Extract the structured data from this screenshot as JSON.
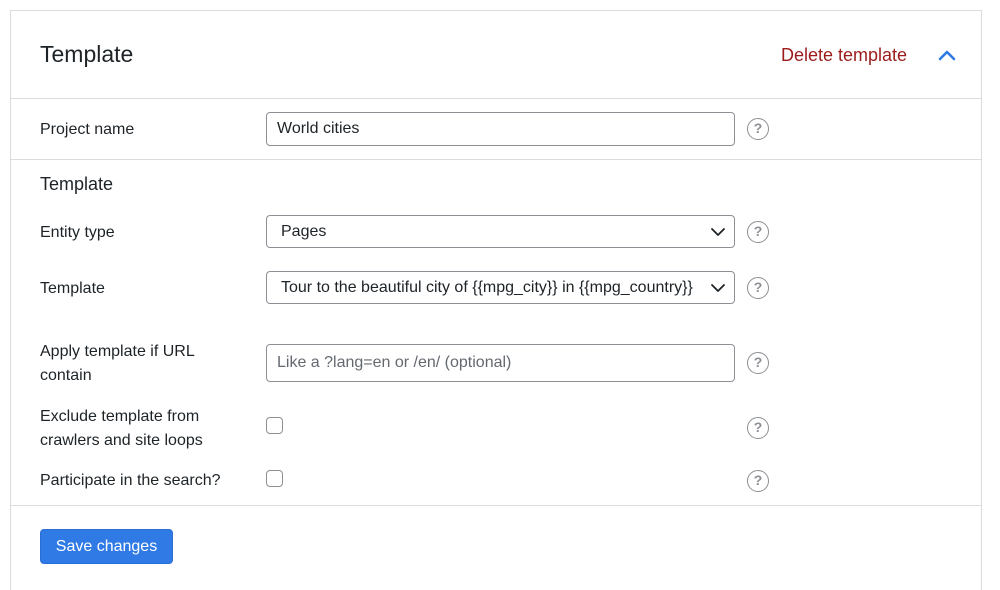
{
  "header": {
    "title": "Template",
    "delete_label": "Delete template",
    "collapse_icon": "chevron-up-icon"
  },
  "project_name": {
    "label": "Project name",
    "value": "World cities"
  },
  "template_section": {
    "title": "Template",
    "entity_type": {
      "label": "Entity type",
      "selected": "Pages"
    },
    "template": {
      "label": "Template",
      "selected": "Tour to the beautiful city of {{mpg_city}} in {{mpg_country}}"
    },
    "url_filter": {
      "label_line1": "Apply template if URL",
      "label_line2": "contain",
      "placeholder": "Like a ?lang=en or /en/ (optional)",
      "value": ""
    },
    "exclude_crawlers": {
      "label_line1": "Exclude template from",
      "label_line2": "crawlers and site loops",
      "checked": false
    },
    "participate_search": {
      "label": "Participate in the search?",
      "checked": false
    }
  },
  "help_symbol": "?",
  "footer": {
    "save_label": "Save changes"
  },
  "colors": {
    "delete": "#9c1c1c",
    "accent": "#2f7ae5",
    "border": "#8c8f94",
    "divider": "#dcdcde"
  }
}
